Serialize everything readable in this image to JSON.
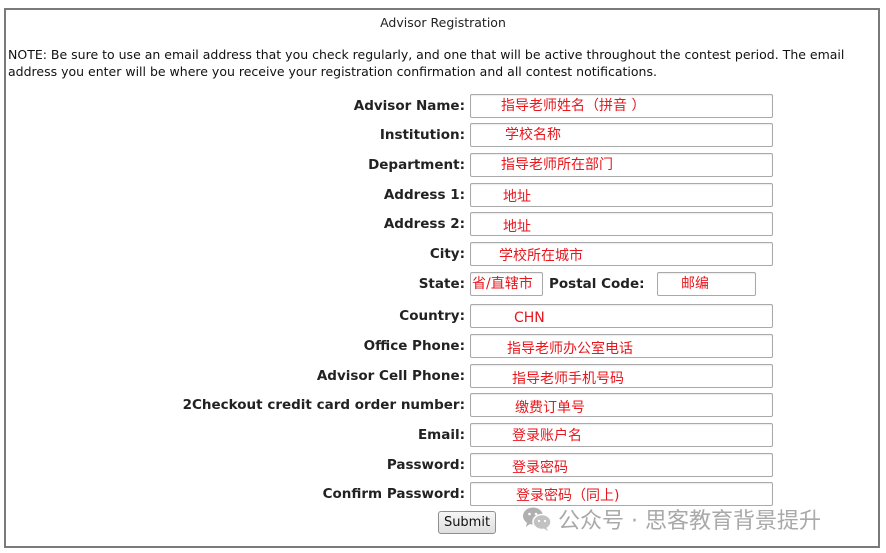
{
  "page": {
    "title": "Advisor Registration",
    "note": "NOTE: Be sure to use an email address that you check regularly, and one that will be active throughout the contest period. The email address you enter will be where you receive your registration confirmation and all contest notifications."
  },
  "form": {
    "fields": [
      {
        "label": "Advisor Name:",
        "value": "指导老师姓名（拼音 ）"
      },
      {
        "label": "Institution:",
        "value": "学校名称"
      },
      {
        "label": "Department:",
        "value": "指导老师所在部门"
      },
      {
        "label": "Address 1:",
        "value": "地址"
      },
      {
        "label": "Address 2:",
        "value": "地址"
      },
      {
        "label": "City:",
        "value": "学校所在城市"
      },
      {
        "label": "State:",
        "value": "省/直辖市"
      },
      {
        "label": "Postal Code:",
        "value": "邮编"
      },
      {
        "label": "Country:",
        "value": "CHN"
      },
      {
        "label": "Office Phone:",
        "value": "指导老师办公室电话"
      },
      {
        "label": "Advisor Cell Phone:",
        "value": "指导老师手机号码"
      },
      {
        "label": "2Checkout credit card order number:",
        "value": "缴费订单号"
      },
      {
        "label": "Email:",
        "value": "登录账户名"
      },
      {
        "label": "Password:",
        "value": "登录密码"
      },
      {
        "label": "Confirm Password:",
        "value": "登录密码（同上)"
      }
    ],
    "submit_label": "Submit"
  },
  "watermark": {
    "icon": "wechat-icon",
    "text": "公众号 · 思客教育背景提升"
  },
  "colors": {
    "annotation": "#e8171d",
    "border": "#7a7a7a"
  }
}
